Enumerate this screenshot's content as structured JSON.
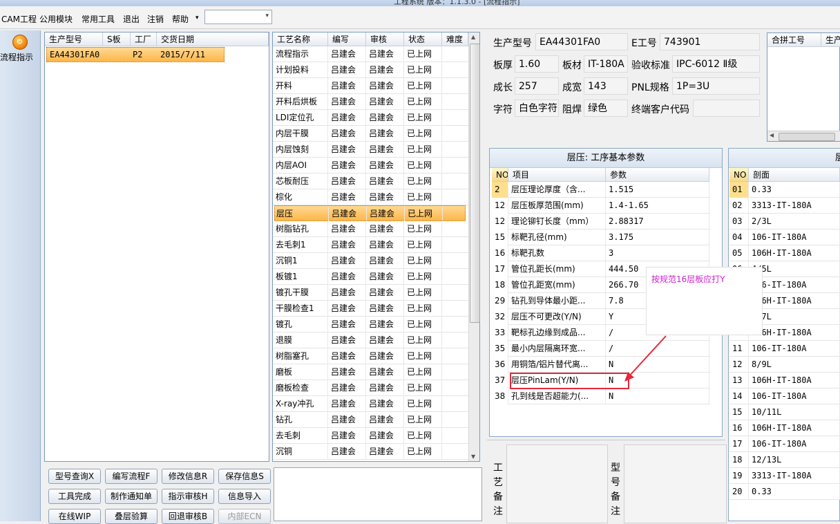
{
  "window": {
    "title": "工程系统  版本：1.1.3.0 - [流程指示]"
  },
  "menu": {
    "items": [
      "CAM工程",
      "公用模块",
      "常用工具",
      "退出",
      "注销",
      "帮助"
    ],
    "dropdown_arrow": "▾"
  },
  "nav": {
    "flow_label": "流程指示",
    "flow_icon_text": "⏻"
  },
  "order_grid": {
    "headers": [
      "生产型号",
      "S板",
      "工厂",
      "交货日期"
    ],
    "rows": [
      [
        "EA44301FA0",
        "",
        "P2",
        "2015/7/11"
      ]
    ]
  },
  "process_grid": {
    "headers": [
      "工艺名称",
      "编写",
      "审核",
      "状态",
      "难度"
    ],
    "rows": [
      [
        "流程指示",
        "吕建会",
        "吕建会",
        "已上网"
      ],
      [
        "计划投料",
        "吕建会",
        "吕建会",
        "已上网"
      ],
      [
        "开料",
        "吕建会",
        "吕建会",
        "已上网"
      ],
      [
        "开料后烘板",
        "吕建会",
        "吕建会",
        "已上网"
      ],
      [
        "LDI定位孔",
        "吕建会",
        "吕建会",
        "已上网"
      ],
      [
        "内层干膜",
        "吕建会",
        "吕建会",
        "已上网"
      ],
      [
        "内层蚀刻",
        "吕建会",
        "吕建会",
        "已上网"
      ],
      [
        "内层AOI",
        "吕建会",
        "吕建会",
        "已上网"
      ],
      [
        "芯板耐压",
        "吕建会",
        "吕建会",
        "已上网"
      ],
      [
        "棕化",
        "吕建会",
        "吕建会",
        "已上网"
      ],
      [
        "层压",
        "吕建会",
        "吕建会",
        "已上网"
      ],
      [
        "树脂钻孔",
        "吕建会",
        "吕建会",
        "已上网"
      ],
      [
        "去毛刺1",
        "吕建会",
        "吕建会",
        "已上网"
      ],
      [
        "沉铜1",
        "吕建会",
        "吕建会",
        "已上网"
      ],
      [
        "板镀1",
        "吕建会",
        "吕建会",
        "已上网"
      ],
      [
        "镀孔干膜",
        "吕建会",
        "吕建会",
        "已上网"
      ],
      [
        "干膜检查1",
        "吕建会",
        "吕建会",
        "已上网"
      ],
      [
        "镀孔",
        "吕建会",
        "吕建会",
        "已上网"
      ],
      [
        "退膜",
        "吕建会",
        "吕建会",
        "已上网"
      ],
      [
        "树脂塞孔",
        "吕建会",
        "吕建会",
        "已上网"
      ],
      [
        "磨板",
        "吕建会",
        "吕建会",
        "已上网"
      ],
      [
        "磨板检查",
        "吕建会",
        "吕建会",
        "已上网"
      ],
      [
        "X-ray冲孔",
        "吕建会",
        "吕建会",
        "已上网"
      ],
      [
        "钻孔",
        "吕建会",
        "吕建会",
        "已上网"
      ],
      [
        "去毛刺",
        "吕建会",
        "吕建会",
        "已上网"
      ],
      [
        "沉铜",
        "吕建会",
        "吕建会",
        "已上网"
      ]
    ]
  },
  "info": {
    "model_label": "生产型号",
    "model_value": "EA44301FA0",
    "eno_label": "E工号",
    "eno_value": "743901",
    "thickness_label": "板厚",
    "thickness_value": "1.60",
    "material_label": "板材",
    "material_value": "IT-180A",
    "standard_label": "验收标准",
    "standard_value": "IPC-6012 Ⅱ级",
    "length_label": "成长",
    "length_value": "257",
    "width_label": "成宽",
    "width_value": "143",
    "pnl_label": "PNL规格",
    "pnl_value": "1P=3U",
    "char_label": "字符",
    "char_value": "白色字符",
    "mask_label": "阻焊",
    "mask_value": "绿色",
    "customer_label": "终端客户代码",
    "customer_value": ""
  },
  "merge_grid": {
    "headers": [
      "合拼工号",
      "生产"
    ]
  },
  "params": {
    "title": "层压: 工序基本参数",
    "headers": [
      "NO",
      "项目",
      "参数"
    ],
    "rows": [
      [
        "2",
        "层压理论厚度（含...",
        "1.515"
      ],
      [
        "12",
        "层压板厚范围(mm)",
        "1.4-1.65"
      ],
      [
        "12",
        "理论铆钉长度（mm）",
        "2.88317"
      ],
      [
        "15",
        "标靶孔径(mm)",
        "3.175"
      ],
      [
        "16",
        "标靶孔数",
        "3"
      ],
      [
        "17",
        "管位孔距长(mm)",
        "444.50"
      ],
      [
        "18",
        "管位孔距宽(mm)",
        "266.70"
      ],
      [
        "29",
        "钻孔到导体最小距...",
        "7.8"
      ],
      [
        "32",
        "层压不可更改(Y/N)",
        "Y"
      ],
      [
        "33",
        "靶标孔边缘到成品...",
        "/"
      ],
      [
        "35",
        "最小内层隔离环宽...",
        "/"
      ],
      [
        "36",
        "用铜箔/铝片替代离...",
        "N"
      ],
      [
        "37",
        "层压PinLam(Y/N)",
        "N"
      ],
      [
        "38",
        "孔到线是否超能力(...",
        "N"
      ]
    ]
  },
  "section": {
    "title": "层",
    "headers": [
      "NO",
      "剖面"
    ],
    "rows": [
      [
        "01",
        "0.33"
      ],
      [
        "02",
        "3313-IT-180A"
      ],
      [
        "03",
        "2/3L"
      ],
      [
        "04",
        "106-IT-180A"
      ],
      [
        "05",
        "106H-IT-180A"
      ],
      [
        "06",
        "4/5L"
      ],
      [
        "07",
        "106-IT-180A"
      ],
      [
        "08",
        "106H-IT-180A"
      ],
      [
        "09",
        "6/7L"
      ],
      [
        "10",
        "106H-IT-180A"
      ],
      [
        "11",
        "106-IT-180A"
      ],
      [
        "12",
        "8/9L"
      ],
      [
        "13",
        "106H-IT-180A"
      ],
      [
        "14",
        "106-IT-180A"
      ],
      [
        "15",
        "10/11L"
      ],
      [
        "16",
        "106H-IT-180A"
      ],
      [
        "17",
        "106-IT-180A"
      ],
      [
        "18",
        "12/13L"
      ],
      [
        "19",
        "3313-IT-180A"
      ],
      [
        "20",
        "0.33"
      ]
    ]
  },
  "notes": {
    "process_label": "工艺备注",
    "model_label": "型号备注"
  },
  "buttons": {
    "row1": [
      "型号查询X",
      "编写流程F",
      "修改信息R",
      "保存信息S"
    ],
    "row2": [
      "工具完成",
      "制作通知单",
      "指示审核H",
      "信息导入"
    ],
    "row3": [
      "在线WIP",
      "叠层验算",
      "回退审核B",
      "内部ECN"
    ]
  },
  "annotation": {
    "text": "按规范16层板应打Y",
    "color": "#cc22cc",
    "highlight_color": "#e5283a"
  }
}
